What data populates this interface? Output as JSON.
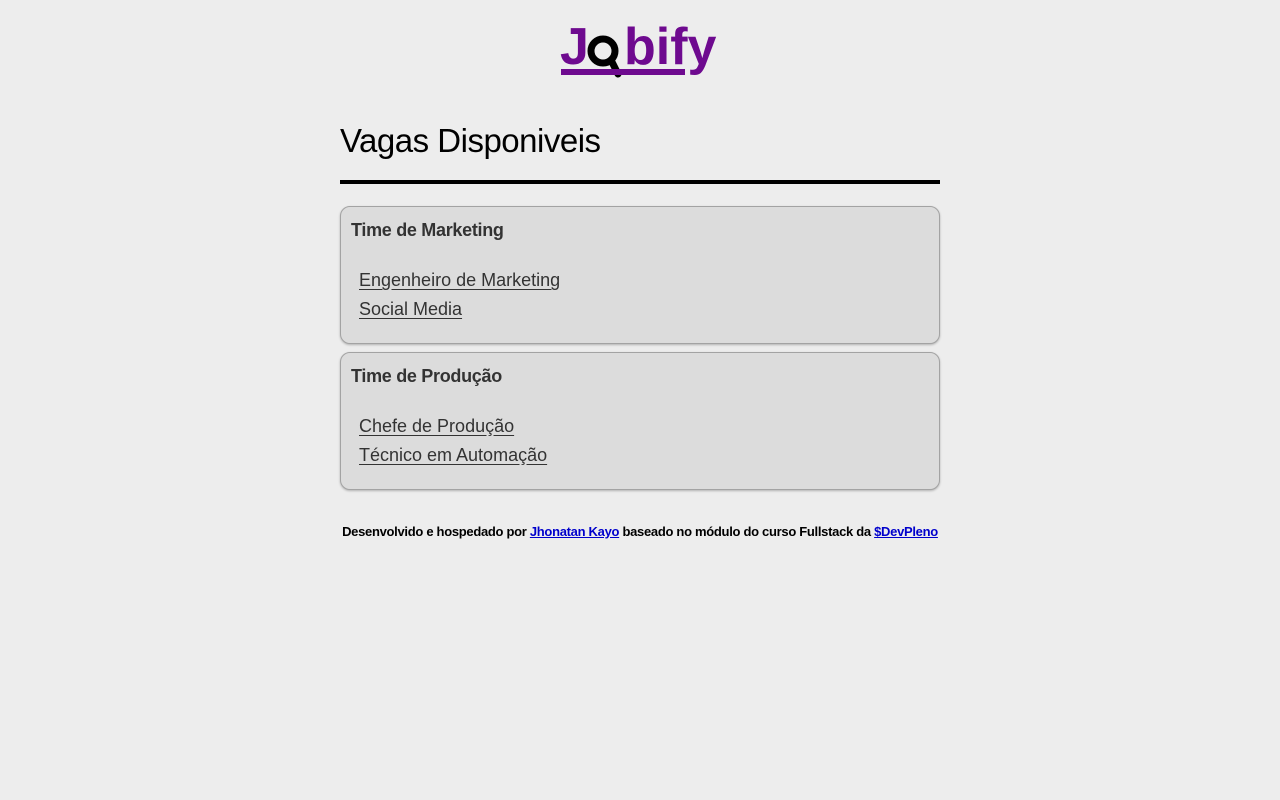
{
  "header": {
    "logo": {
      "text": "Jobify",
      "color_primary": "#6e0a8f",
      "color_magnifier": "#000000"
    }
  },
  "main": {
    "title": "Vagas Disponiveis",
    "categories": [
      {
        "title": "Time de Marketing",
        "jobs": [
          "Engenheiro de Marketing",
          "Social Media"
        ]
      },
      {
        "title": "Time de Produção",
        "jobs": [
          "Chefe de Produção",
          "Técnico em Automação"
        ]
      }
    ]
  },
  "footer": {
    "prefix": "Desenvolvido e hospedado por ",
    "author_link": "Jhonatan Kayo",
    "middle": " baseado no módulo do curso Fullstack da ",
    "course_link": "$DevPleno"
  }
}
